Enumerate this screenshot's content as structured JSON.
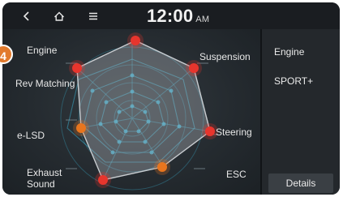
{
  "header": {
    "time": "12:00",
    "ampm": "AM"
  },
  "icons": {
    "back": "back-arrow-icon",
    "home": "home-icon",
    "menu": "menu-icon"
  },
  "radar": {
    "labels": {
      "engine": "Engine",
      "suspension": "Suspension",
      "rev_matching": "Rev Matching",
      "steering": "Steering",
      "e_lsd": "e-LSD",
      "esc": "ESC",
      "exhaust_sound": "Exhaust Sound"
    },
    "callout_number": "4",
    "colors": {
      "active_node": "#e8352d",
      "partial_node": "#e8751e",
      "polygon_fill": "rgba(195,200,205,0.35)",
      "grid": "#3aa9c8"
    }
  },
  "info_panel": {
    "title": "Engine",
    "value": "SPORT+",
    "details_label": "Details"
  }
}
